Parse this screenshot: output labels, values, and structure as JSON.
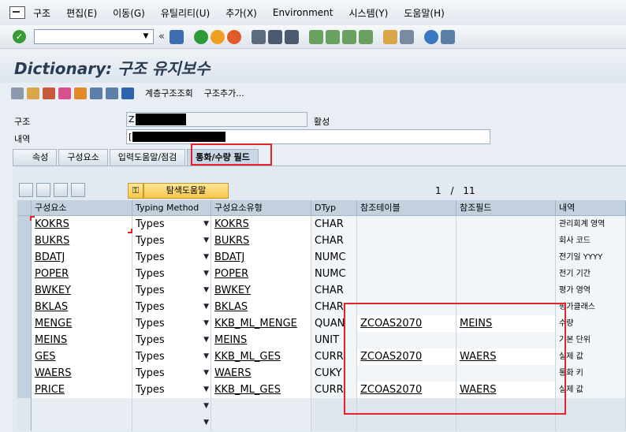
{
  "menubar": {
    "items": [
      "구조",
      "편집(E)",
      "이동(G)",
      "유틸리티(U)",
      "추가(X)",
      "Environment",
      "시스템(Y)",
      "도움말(H)"
    ]
  },
  "toolbar": {
    "command_value": "",
    "back_glyph": "«"
  },
  "title": "Dictionary: 구조 유지보수",
  "app_toolbar": {
    "hierarchy_label": "계층구조조회",
    "append_label": "구조추가..."
  },
  "form": {
    "structure_label": "구조",
    "structure_value": "Z",
    "status": "활성",
    "description_label": "내역",
    "description_value": "["
  },
  "tabs": [
    "속성",
    "구성요소",
    "입력도움말/점검",
    "통화/수량 필드"
  ],
  "active_tab": 3,
  "panel": {
    "search_help_label": "탐색도움말",
    "page_current": "1",
    "page_sep": "/",
    "page_total": "11"
  },
  "grid": {
    "headers": [
      "구성요소",
      "Typing Method",
      "구성요소유형",
      "DTyp",
      "참조테이블",
      "참조필드",
      "내역"
    ],
    "rows": [
      {
        "comp": "KOKRS",
        "typing": "Types",
        "type": "KOKRS",
        "dtyp": "CHAR",
        "rtab": "",
        "rfld": "",
        "desc": "관리회계 영역"
      },
      {
        "comp": "BUKRS",
        "typing": "Types",
        "type": "BUKRS",
        "dtyp": "CHAR",
        "rtab": "",
        "rfld": "",
        "desc": "회사 코드"
      },
      {
        "comp": "BDATJ",
        "typing": "Types",
        "type": "BDATJ",
        "dtyp": "NUMC",
        "rtab": "",
        "rfld": "",
        "desc": "전기일 YYYY"
      },
      {
        "comp": "POPER",
        "typing": "Types",
        "type": "POPER",
        "dtyp": "NUMC",
        "rtab": "",
        "rfld": "",
        "desc": "전기 기간"
      },
      {
        "comp": "BWKEY",
        "typing": "Types",
        "type": "BWKEY",
        "dtyp": "CHAR",
        "rtab": "",
        "rfld": "",
        "desc": "평가 영역"
      },
      {
        "comp": "BKLAS",
        "typing": "Types",
        "type": "BKLAS",
        "dtyp": "CHAR",
        "rtab": "",
        "rfld": "",
        "desc": "평가클래스"
      },
      {
        "comp": "MENGE",
        "typing": "Types",
        "type": "KKB_ML_MENGE",
        "dtyp": "QUAN",
        "rtab": "ZCOAS2070",
        "rfld": "MEINS",
        "desc": "수량"
      },
      {
        "comp": "MEINS",
        "typing": "Types",
        "type": "MEINS",
        "dtyp": "UNIT",
        "rtab": "",
        "rfld": "",
        "desc": "기본 단위"
      },
      {
        "comp": "GES",
        "typing": "Types",
        "type": "KKB_ML_GES",
        "dtyp": "CURR",
        "rtab": "ZCOAS2070",
        "rfld": "WAERS",
        "desc": "실제 값"
      },
      {
        "comp": "WAERS",
        "typing": "Types",
        "type": "WAERS",
        "dtyp": "CUKY",
        "rtab": "",
        "rfld": "",
        "desc": "통화 키"
      },
      {
        "comp": "PRICE",
        "typing": "Types",
        "type": "KKB_ML_GES",
        "dtyp": "CURR",
        "rtab": "ZCOAS2070",
        "rfld": "WAERS",
        "desc": "실제 값"
      }
    ]
  },
  "colors": {
    "highlight": "#e3232b",
    "header": "#c3d1df"
  }
}
